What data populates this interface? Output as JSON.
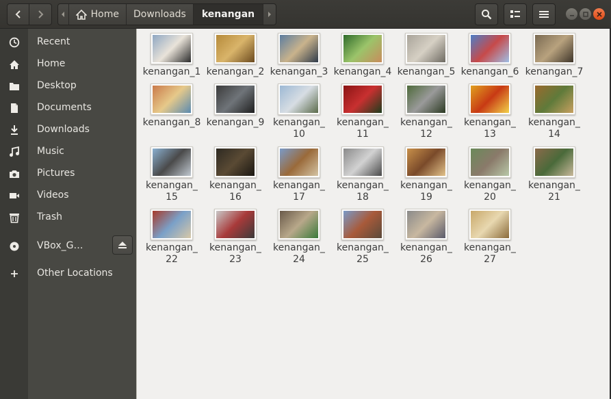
{
  "header": {
    "path": [
      {
        "label": "Home",
        "icon": "home-icon"
      },
      {
        "label": "Downloads"
      },
      {
        "label": "kenangan",
        "current": true
      }
    ]
  },
  "sidebar": {
    "items": [
      {
        "label": "Recent",
        "icon": "clock-icon"
      },
      {
        "label": "Home",
        "icon": "home-icon"
      },
      {
        "label": "Desktop",
        "icon": "folder-icon"
      },
      {
        "label": "Documents",
        "icon": "document-icon"
      },
      {
        "label": "Downloads",
        "icon": "download-icon"
      },
      {
        "label": "Music",
        "icon": "music-icon"
      },
      {
        "label": "Pictures",
        "icon": "camera-icon"
      },
      {
        "label": "Videos",
        "icon": "video-icon"
      },
      {
        "label": "Trash",
        "icon": "trash-icon"
      },
      {
        "label": "VBox_G…",
        "icon": "disc-icon"
      },
      {
        "label": "Other Locations",
        "icon": "plus-icon"
      }
    ]
  },
  "files": [
    {
      "l1": "kenangan_1",
      "l2": "",
      "colors": [
        "#8fa7c2",
        "#e9e3d9",
        "#2b2b2b"
      ]
    },
    {
      "l1": "kenangan_2",
      "l2": "",
      "colors": [
        "#b58a3a",
        "#d9b46a",
        "#6b4a1e"
      ]
    },
    {
      "l1": "kenangan_3",
      "l2": "",
      "colors": [
        "#5c7da0",
        "#c9b38c",
        "#2f3b4a"
      ]
    },
    {
      "l1": "kenangan_4",
      "l2": "",
      "colors": [
        "#2f6b2a",
        "#9bc46a",
        "#c88c5c"
      ]
    },
    {
      "l1": "kenangan_5",
      "l2": "",
      "colors": [
        "#a9a49a",
        "#d6d0c4",
        "#6e6a62"
      ]
    },
    {
      "l1": "kenangan_6",
      "l2": "",
      "colors": [
        "#4d7fc7",
        "#c74a4a",
        "#9fbfe6"
      ]
    },
    {
      "l1": "kenangan_7",
      "l2": "",
      "colors": [
        "#7a6a52",
        "#b8a27e",
        "#3e352a"
      ]
    },
    {
      "l1": "kenangan_8",
      "l2": "",
      "colors": [
        "#c97a4a",
        "#e6c98a",
        "#5a8ab0"
      ]
    },
    {
      "l1": "kenangan_9",
      "l2": "",
      "colors": [
        "#3b3b3b",
        "#6f7479",
        "#1e1e1e"
      ]
    },
    {
      "l1": "kenangan_",
      "l2": "10",
      "colors": [
        "#9cb8d4",
        "#d7dde3",
        "#5b6b4a"
      ]
    },
    {
      "l1": "kenangan_",
      "l2": "11",
      "colors": [
        "#8a1414",
        "#c83030",
        "#1d3d1d"
      ]
    },
    {
      "l1": "kenangan_",
      "l2": "12",
      "colors": [
        "#4e6a3a",
        "#9a9a9a",
        "#2c3a22"
      ]
    },
    {
      "l1": "kenangan_",
      "l2": "13",
      "colors": [
        "#e0a020",
        "#c83a14",
        "#f2d24a"
      ]
    },
    {
      "l1": "kenangan_",
      "l2": "14",
      "colors": [
        "#9a6a2e",
        "#5f7a3a",
        "#c8a060"
      ]
    },
    {
      "l1": "kenangan_",
      "l2": "15",
      "colors": [
        "#8ab0d0",
        "#4a4a4a",
        "#c0c8d0"
      ]
    },
    {
      "l1": "kenangan_",
      "l2": "16",
      "colors": [
        "#2e2a22",
        "#5a4a34",
        "#1a1712"
      ]
    },
    {
      "l1": "kenangan_",
      "l2": "17",
      "colors": [
        "#7a9ac8",
        "#9a6a3a",
        "#d4c4a4"
      ]
    },
    {
      "l1": "kenangan_",
      "l2": "18",
      "colors": [
        "#8a8a8a",
        "#d2d2d2",
        "#4a4a4a"
      ]
    },
    {
      "l1": "kenangan_",
      "l2": "19",
      "colors": [
        "#c8904a",
        "#7a4a2a",
        "#e2c28a"
      ]
    },
    {
      "l1": "kenangan_",
      "l2": "20",
      "colors": [
        "#6a8a5a",
        "#8a7a6a",
        "#b8c8a8"
      ]
    },
    {
      "l1": "kenangan_",
      "l2": "21",
      "colors": [
        "#8a6a4a",
        "#4a6a3a",
        "#c8b89a"
      ]
    },
    {
      "l1": "kenangan_",
      "l2": "22",
      "colors": [
        "#a83a2a",
        "#7aa0c8",
        "#d8c8a8"
      ]
    },
    {
      "l1": "kenangan_",
      "l2": "23",
      "colors": [
        "#c8c8c8",
        "#a83a3a",
        "#3a3a3a"
      ]
    },
    {
      "l1": "kenangan_",
      "l2": "24",
      "colors": [
        "#6a5a4a",
        "#b8a88a",
        "#3a7a3a"
      ]
    },
    {
      "l1": "kenangan_",
      "l2": "25",
      "colors": [
        "#7a9ac8",
        "#a85a3a",
        "#5a4a3a"
      ]
    },
    {
      "l1": "kenangan_",
      "l2": "26",
      "colors": [
        "#8a8a8a",
        "#c8b8a0",
        "#5a5a6a"
      ]
    },
    {
      "l1": "kenangan_",
      "l2": "27",
      "colors": [
        "#c8a86a",
        "#e8d8b0",
        "#8a6a3a"
      ]
    }
  ]
}
